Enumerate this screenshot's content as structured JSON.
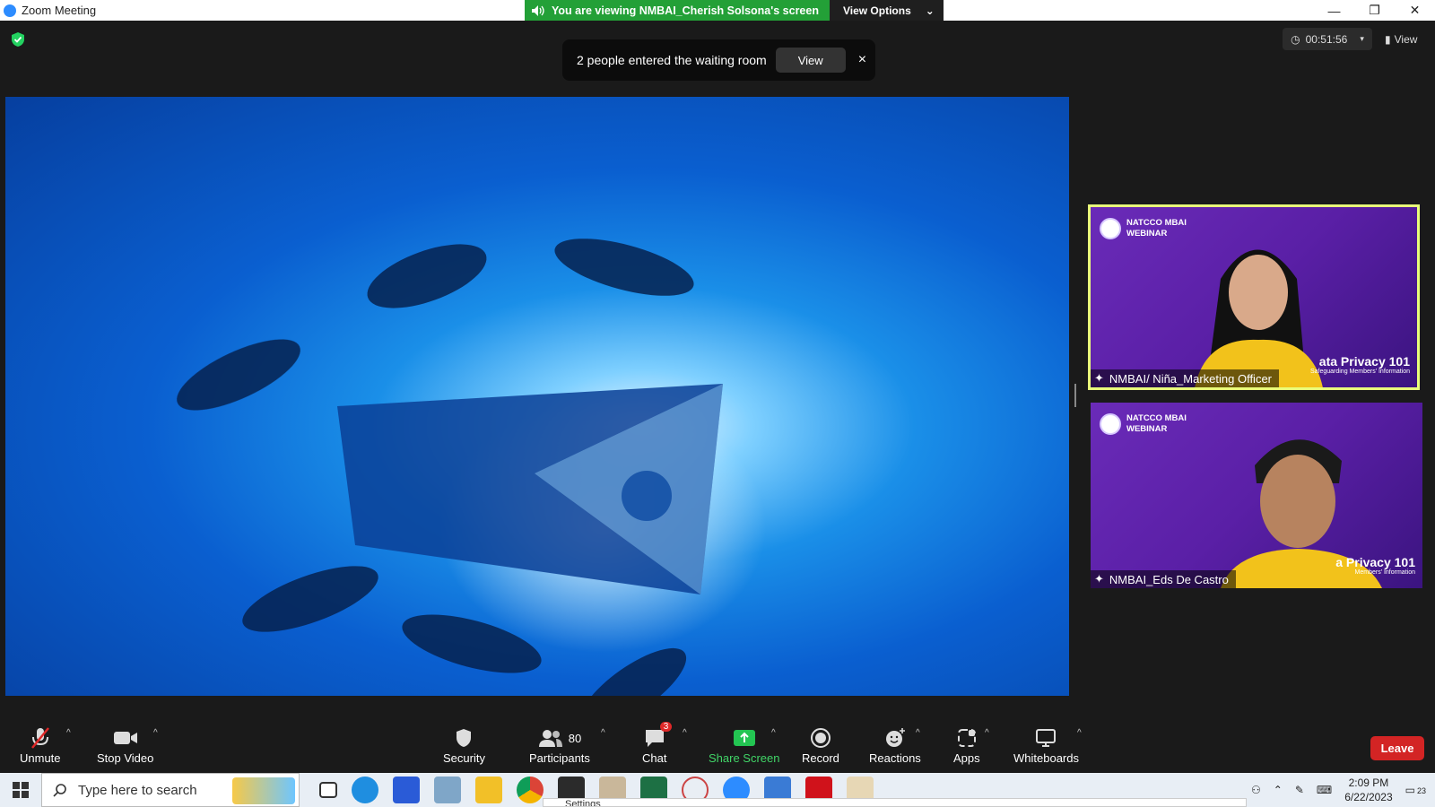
{
  "window": {
    "title": "Zoom Meeting",
    "share_banner": "You are viewing NMBAI_Cherish Solsona's screen",
    "view_options": "View Options"
  },
  "top": {
    "timer": "00:51:56",
    "view_label": "View"
  },
  "notification": {
    "text": "2 people entered the waiting room",
    "view_button": "View",
    "close": "×"
  },
  "participants_tiles": [
    {
      "name": "NMBAI/ Niña_Marketing Officer",
      "brand_line1": "NATCCO MBAI",
      "brand_line2": "WEBINAR",
      "slide_title": "ata Privacy 101",
      "slide_sub": "Safeguarding Members' Information"
    },
    {
      "name": "NMBAI_Eds De Castro",
      "brand_line1": "NATCCO MBAI",
      "brand_line2": "WEBINAR",
      "slide_title": "a Privacy 101",
      "slide_sub": "Members' Information"
    }
  ],
  "toolbar": {
    "unmute": "Unmute",
    "stop_video": "Stop Video",
    "security": "Security",
    "participants": "Participants",
    "participants_count": "80",
    "chat": "Chat",
    "chat_badge": "3",
    "share_screen": "Share Screen",
    "record": "Record",
    "reactions": "Reactions",
    "apps": "Apps",
    "whiteboards": "Whiteboards",
    "leave": "Leave"
  },
  "taskbar": {
    "search_placeholder": "Type here to search",
    "time": "2:09 PM",
    "date": "6/22/2023",
    "notifications_count": "23",
    "popup_label": "Settings"
  },
  "colors": {
    "zoom_green": "#23a037",
    "leave_red": "#d32424",
    "active_speaker": "#e9ff7a",
    "tile_purple": "#5a1fa6"
  }
}
